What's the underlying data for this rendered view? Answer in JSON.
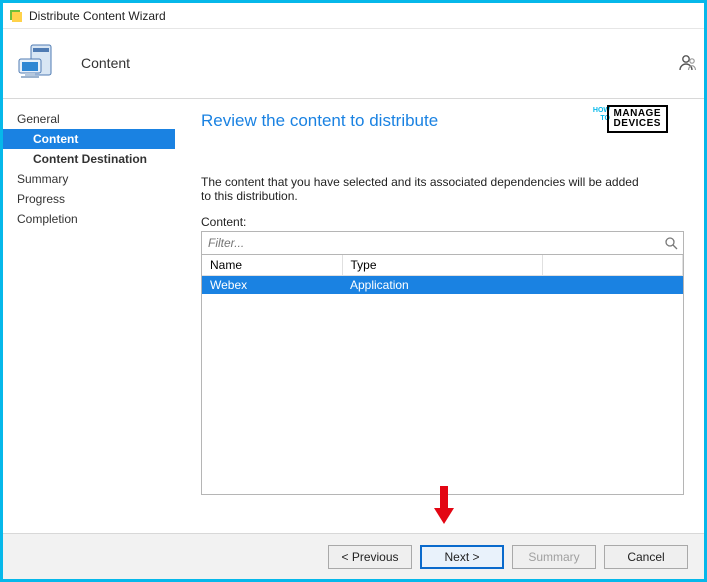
{
  "window": {
    "title": "Distribute Content Wizard"
  },
  "header": {
    "page_title": "Content"
  },
  "sidebar": {
    "items": [
      {
        "label": "General",
        "level": 0,
        "selected": false
      },
      {
        "label": "Content",
        "level": 1,
        "selected": true
      },
      {
        "label": "Content Destination",
        "level": 1,
        "selected": false
      },
      {
        "label": "Summary",
        "level": 0,
        "selected": false
      },
      {
        "label": "Progress",
        "level": 0,
        "selected": false
      },
      {
        "label": "Completion",
        "level": 0,
        "selected": false
      }
    ]
  },
  "main": {
    "heading": "Review the content to distribute",
    "description": "The content that you have selected and its associated dependencies will be added to this distribution.",
    "content_label": "Content:",
    "filter_placeholder": "Filter...",
    "columns": {
      "name": "Name",
      "type": "Type"
    },
    "rows": [
      {
        "name": "Webex",
        "type": "Application"
      }
    ]
  },
  "watermark": {
    "side1": "HOW",
    "side2": "TO",
    "line1": "MANAGE",
    "line2": "DEVICES"
  },
  "buttons": {
    "previous": "< Previous",
    "next": "Next >",
    "summary": "Summary",
    "cancel": "Cancel"
  }
}
